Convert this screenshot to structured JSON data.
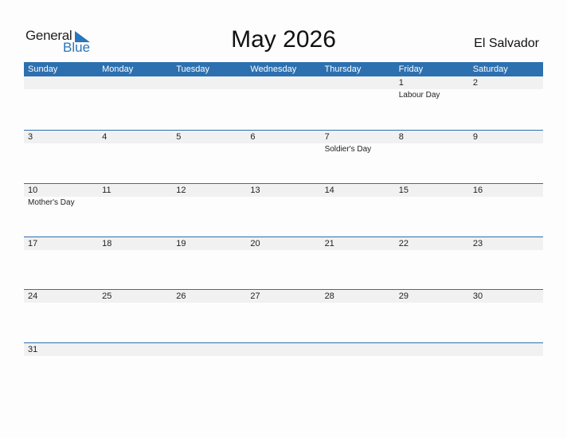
{
  "logo": {
    "word1": "General",
    "word2": "Blue"
  },
  "title": "May 2026",
  "country": "El Salvador",
  "colors": {
    "accent": "#2d70b0",
    "strip": "#f1f1f1"
  },
  "weekdays": [
    "Sunday",
    "Monday",
    "Tuesday",
    "Wednesday",
    "Thursday",
    "Friday",
    "Saturday"
  ],
  "weeks": [
    [
      {
        "day": ""
      },
      {
        "day": ""
      },
      {
        "day": ""
      },
      {
        "day": ""
      },
      {
        "day": ""
      },
      {
        "day": "1",
        "event": "Labour Day"
      },
      {
        "day": "2"
      }
    ],
    [
      {
        "day": "3"
      },
      {
        "day": "4"
      },
      {
        "day": "5"
      },
      {
        "day": "6"
      },
      {
        "day": "7",
        "event": "Soldier's Day"
      },
      {
        "day": "8"
      },
      {
        "day": "9"
      }
    ],
    [
      {
        "day": "10",
        "event": "Mother's Day"
      },
      {
        "day": "11"
      },
      {
        "day": "12"
      },
      {
        "day": "13"
      },
      {
        "day": "14"
      },
      {
        "day": "15"
      },
      {
        "day": "16"
      }
    ],
    [
      {
        "day": "17"
      },
      {
        "day": "18"
      },
      {
        "day": "19"
      },
      {
        "day": "20"
      },
      {
        "day": "21"
      },
      {
        "day": "22"
      },
      {
        "day": "23"
      }
    ],
    [
      {
        "day": "24"
      },
      {
        "day": "25"
      },
      {
        "day": "26"
      },
      {
        "day": "27"
      },
      {
        "day": "28"
      },
      {
        "day": "29"
      },
      {
        "day": "30"
      }
    ],
    [
      {
        "day": "31"
      },
      {
        "day": ""
      },
      {
        "day": ""
      },
      {
        "day": ""
      },
      {
        "day": ""
      },
      {
        "day": ""
      },
      {
        "day": ""
      }
    ]
  ]
}
